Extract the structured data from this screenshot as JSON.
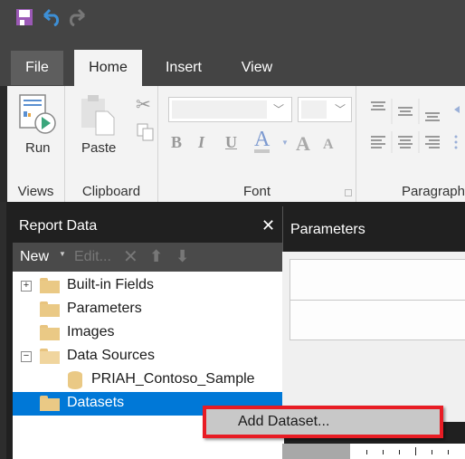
{
  "quick_access": {
    "save_icon": "floppy-disk-icon",
    "undo_icon": "undo-icon",
    "redo_icon": "redo-icon"
  },
  "tabs": [
    {
      "label": "File",
      "active": false
    },
    {
      "label": "Home",
      "active": true
    },
    {
      "label": "Insert",
      "active": false
    },
    {
      "label": "View",
      "active": false
    }
  ],
  "ribbon": {
    "groups": {
      "views": {
        "label": "Views",
        "run_label": "Run"
      },
      "clipboard": {
        "label": "Clipboard",
        "paste_label": "Paste"
      },
      "font": {
        "label": "Font",
        "font_name": "",
        "font_size": "",
        "bold": "B",
        "italic": "I",
        "underline": "U",
        "font_color": "A",
        "grow": "A",
        "shrink": "A"
      },
      "paragraph": {
        "label": "Paragraph"
      }
    }
  },
  "report_data": {
    "title": "Report Data",
    "close": "✕",
    "toolbar": {
      "new_label": "New",
      "edit_label": "Edit..."
    },
    "tree": [
      {
        "label": "Built-in Fields",
        "expander": "+",
        "type": "folder"
      },
      {
        "label": "Parameters",
        "expander": "",
        "type": "folder"
      },
      {
        "label": "Images",
        "expander": "",
        "type": "folder"
      },
      {
        "label": "Data Sources",
        "expander": "−",
        "type": "folder-open"
      },
      {
        "label": "PRIAH_Contoso_Sample",
        "expander": "",
        "type": "datasource"
      },
      {
        "label": "Datasets",
        "expander": "",
        "type": "folder",
        "selected": true
      }
    ]
  },
  "parameters_pane": {
    "title": "Parameters"
  },
  "context_menu": {
    "items": [
      {
        "label": "Add Dataset..."
      }
    ]
  },
  "colors": {
    "selection": "#0078d7",
    "highlight_border": "#e81c24",
    "folder": "#eac985"
  }
}
